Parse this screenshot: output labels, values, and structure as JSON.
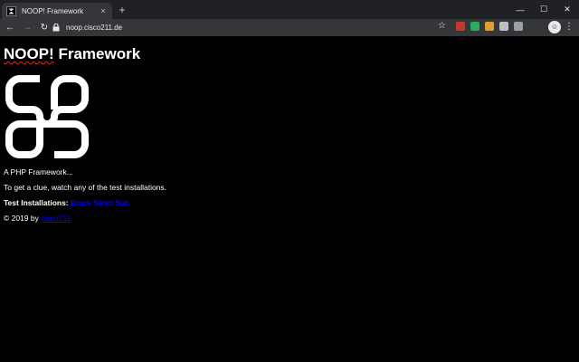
{
  "browser": {
    "tab_title": "NOOP! Framework",
    "tab_close": "×",
    "new_tab": "+",
    "window_controls": {
      "minimize": "—",
      "maximize": "☐",
      "close": "✕"
    },
    "nav": {
      "back": "←",
      "forward": "→",
      "reload": "↻"
    },
    "url": "noop.cisco211.de",
    "star": "☆",
    "menu": "⋮",
    "extensions": [
      {
        "name": "ublock-icon",
        "color": "#c0392b"
      },
      {
        "name": "green-extension-icon",
        "color": "#27ae60"
      },
      {
        "name": "cookie-icon",
        "color": "#e0a030"
      },
      {
        "name": "folder-icon",
        "color": "#bdc1c6"
      },
      {
        "name": "shield-icon",
        "color": "#9aa0a6"
      }
    ]
  },
  "page": {
    "title_noop": "NOOP!",
    "title_rest": " Framework",
    "tagline": "A PHP Framework...",
    "hint": "To get a clue, watch any of the test installations.",
    "test_label": "Test Installations:",
    "test_links": [
      "Black",
      "Strict",
      "Sub"
    ],
    "copyright_prefix": "© 2019 by",
    "author": "cisco211",
    "colors": {
      "background": "#000000",
      "text": "#ffffff",
      "link": "#0000ff"
    }
  }
}
